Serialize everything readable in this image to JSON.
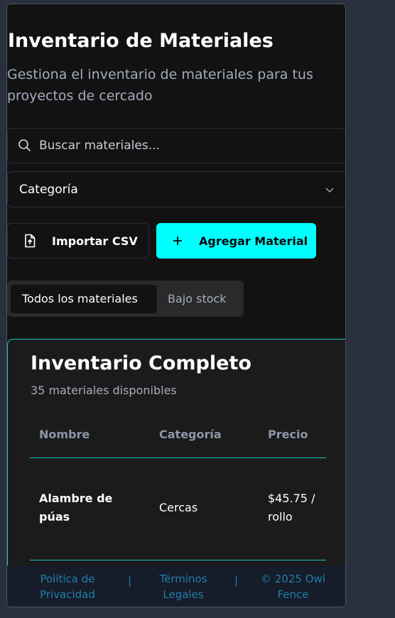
{
  "header": {
    "title": "Inventario de Materiales",
    "subtitle": "Gestiona el inventario de materiales para tus proyectos de cercado"
  },
  "search": {
    "placeholder": "Buscar materiales...",
    "icon": "search-icon"
  },
  "filter": {
    "selected": "Categoría",
    "icon": "chevron-down-icon"
  },
  "actions": {
    "import_label": "Importar CSV",
    "add_label": "Agregar Material",
    "accent": "#00ffff"
  },
  "tabs": [
    {
      "label": "Todos los materiales",
      "active": true
    },
    {
      "label": "Bajo stock",
      "active": false
    }
  ],
  "inventory": {
    "title": "Inventario Completo",
    "count_text": "35 materiales disponibles",
    "columns": [
      "Nombre",
      "Categoría",
      "Precio"
    ],
    "rows": [
      {
        "name": "Alambre de púas",
        "category": "Cercas",
        "price": "$45.75 / rollo"
      }
    ]
  },
  "footer": {
    "privacy": "Política de Privacidad",
    "terms": "Términos Legales",
    "copyright": "© 2025 Owl Fence",
    "separator": "|"
  }
}
